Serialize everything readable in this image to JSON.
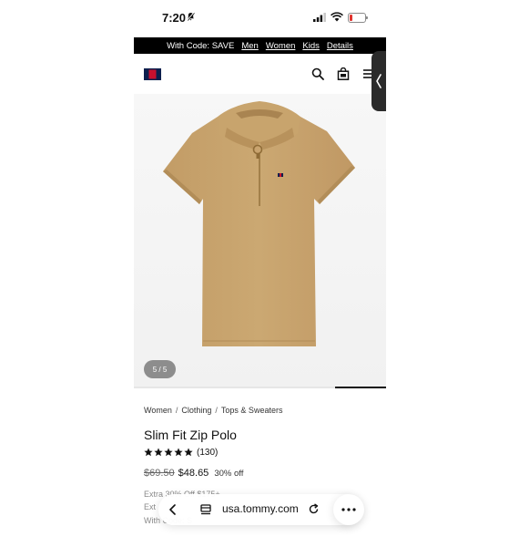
{
  "status_bar": {
    "time": "7:20"
  },
  "promo_bar": {
    "text": "With Code: SAVE",
    "links": [
      "Men",
      "Women",
      "Kids",
      "Details"
    ]
  },
  "header": {
    "logo": "tommy-flag-logo",
    "icons": [
      "search-icon",
      "shopping-bag-icon",
      "menu-icon"
    ]
  },
  "gallery": {
    "counter": "5 / 5",
    "progress": 1.0
  },
  "breadcrumb": [
    "Women",
    "Clothing",
    "Tops & Sweaters"
  ],
  "product": {
    "title": "Slim Fit Zip Polo",
    "rating_stars": 5,
    "review_count": "(130)",
    "original_price": "$69.50",
    "sale_price": "$48.65",
    "discount": "30% off",
    "offers": [
      "Extra 30% Off $175+",
      "Ext",
      "With Code: S"
    ]
  },
  "browser": {
    "url": "usa.tommy.com"
  },
  "colors": {
    "product": "#c9a46f",
    "promo_bg": "#000000",
    "star": "#111111"
  }
}
